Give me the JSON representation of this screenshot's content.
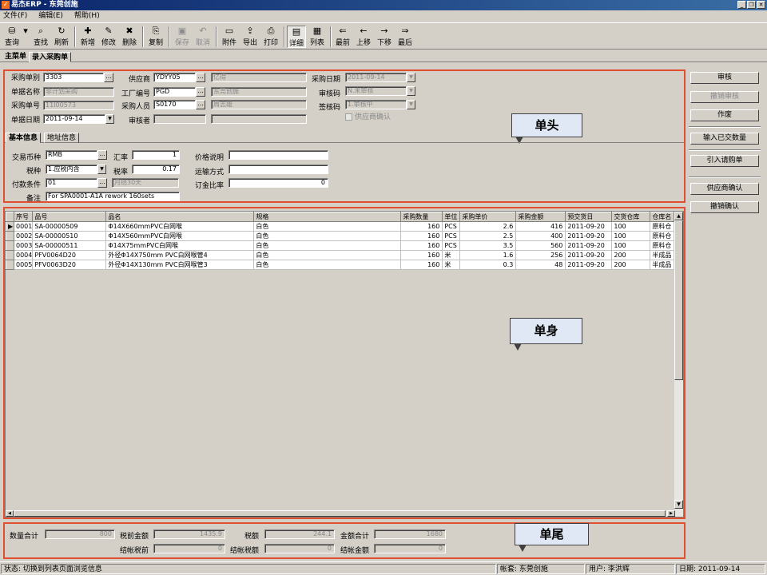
{
  "window": {
    "title": "易杰ERP - 东莞创施"
  },
  "menu": [
    "文件(F)",
    "编辑(E)",
    "帮助(H)"
  ],
  "toolbar": [
    {
      "label": "查询",
      "icon": "query-icon",
      "glyph": "⛁"
    },
    {
      "label": "查找",
      "icon": "find-icon",
      "glyph": "⌕"
    },
    {
      "label": "刷新",
      "icon": "refresh-icon",
      "glyph": "↻"
    },
    {
      "label": "新增",
      "icon": "add-icon",
      "glyph": "✚"
    },
    {
      "label": "修改",
      "icon": "edit-icon",
      "glyph": "✎"
    },
    {
      "label": "删除",
      "icon": "delete-icon",
      "glyph": "✖"
    },
    {
      "label": "复制",
      "icon": "copy-icon",
      "glyph": "⎘"
    },
    {
      "label": "保存",
      "icon": "save-icon",
      "glyph": "▣"
    },
    {
      "label": "取消",
      "icon": "undo-icon",
      "glyph": "↶"
    },
    {
      "label": "附件",
      "icon": "folder-icon",
      "glyph": "▭"
    },
    {
      "label": "导出",
      "icon": "export-icon",
      "glyph": "⇪"
    },
    {
      "label": "打印",
      "icon": "print-icon",
      "glyph": "⎙"
    },
    {
      "label": "详细",
      "icon": "detail-icon",
      "glyph": "▤"
    },
    {
      "label": "列表",
      "icon": "list-icon",
      "glyph": "▦"
    },
    {
      "label": "最前",
      "icon": "first-icon",
      "glyph": "⇐"
    },
    {
      "label": "上移",
      "icon": "prev-icon",
      "glyph": "←"
    },
    {
      "label": "下移",
      "icon": "next-icon",
      "glyph": "→"
    },
    {
      "label": "最后",
      "icon": "last-icon",
      "glyph": "⇒"
    }
  ],
  "tabs": [
    "主菜单",
    "录入采购单"
  ],
  "header": {
    "cg_type_label": "采购单别",
    "cg_type": "3303",
    "doc_name_label": "单据名称",
    "doc_name": "非计划采购",
    "cg_no_label": "采购单号",
    "cg_no": "11I00573",
    "doc_date_label": "单据日期",
    "doc_date": "2011-09-14",
    "supplier_label": "供应商",
    "supplier_code": "YDYY05",
    "supplier_name": "亿得",
    "factory_label": "工厂编号",
    "factory_code": "PGD",
    "factory_name": "东莞创施",
    "buyer_label": "采购人员",
    "buyer_code": "S0170",
    "buyer_name": "周志雄",
    "auditor_label": "审核者",
    "auditor": "",
    "auditor_name": "",
    "cg_date_label": "采购日期",
    "cg_date": "2011-09-14",
    "audit_code_label": "审核码",
    "audit_code": "N.未审核",
    "sign_code_label": "签核码",
    "sign_code": "1.审核中",
    "supplier_confirm": "供应商确认"
  },
  "subtabs": [
    "基本信息",
    "地址信息"
  ],
  "basic": {
    "currency_label": "交易币种",
    "currency": "RMB",
    "tax_type_label": "税种",
    "tax_type": "1.应税内含",
    "pay_terms_label": "付款条件",
    "pay_terms": "01",
    "pay_terms_desc": "月结30天",
    "rate_label": "汇率",
    "rate": "1",
    "tax_rate_label": "税率",
    "tax_rate": "0.17",
    "price_note_label": "价格说明",
    "price_note": "",
    "ship_label": "运输方式",
    "ship": "",
    "deposit_label": "订金比率",
    "deposit": "0",
    "remark_label": "备注",
    "remark": "For SPA0001-A1A rework 160sets"
  },
  "callouts": {
    "head": "单头",
    "body": "单身",
    "tail": "单尾"
  },
  "right_buttons": [
    "审核",
    "撤销审核",
    "作废",
    "输入已交数量",
    "引入请购单",
    "供应商确认",
    "撤销确认"
  ],
  "grid": {
    "columns": [
      "序号",
      "品号",
      "品名",
      "规格",
      "采购数量",
      "单位",
      "采购单价",
      "采购金额",
      "预交货日",
      "交货仓库",
      "仓库名"
    ],
    "rows": [
      [
        "0001",
        "SA-00000509",
        "Φ14X660mmPVC白网喉",
        "白色",
        "160",
        "PCS",
        "2.6",
        "416",
        "2011-09-20",
        "100",
        "原料仓"
      ],
      [
        "0002",
        "SA-00000510",
        "Φ14X560mmPVC白网喉",
        "白色",
        "160",
        "PCS",
        "2.5",
        "400",
        "2011-09-20",
        "100",
        "原料仓"
      ],
      [
        "0003",
        "SA-00000511",
        "Φ14X75mmPVC白网喉",
        "白色",
        "160",
        "PCS",
        "3.5",
        "560",
        "2011-09-20",
        "100",
        "原料仓"
      ],
      [
        "0004",
        "PFV0064D20",
        "外径Φ14X750mm PVC白网喉管4",
        "白色",
        "160",
        "米",
        "1.6",
        "256",
        "2011-09-20",
        "200",
        "半成品"
      ],
      [
        "0005",
        "PFV0063D20",
        "外径Φ14X130mm PVC白网喉管3",
        "白色",
        "160",
        "米",
        "0.3",
        "48",
        "2011-09-20",
        "200",
        "半成品"
      ]
    ]
  },
  "footer": {
    "qty_total_label": "数量合计",
    "qty_total": "800",
    "pretax_label": "税前金额",
    "pretax": "1435.9",
    "tax_label": "税额",
    "tax": "244.1",
    "amount_total_label": "金额合计",
    "amount_total": "1680",
    "settle_pretax_label": "结帐税前",
    "settle_pretax": "0",
    "settle_tax_label": "结帐税额",
    "settle_tax": "0",
    "settle_amount_label": "结帐金额",
    "settle_amount": "0"
  },
  "status": {
    "message": "状态: 切换到列表页面浏览信息",
    "account": "帐套: 东莞创施",
    "user": "用户: 李洪辉",
    "date": "日期: 2011-09-14"
  },
  "colors": {
    "accent_border": "#e05030",
    "title_bar": "#0a246a",
    "callout_fill": "#dfe8f4"
  }
}
